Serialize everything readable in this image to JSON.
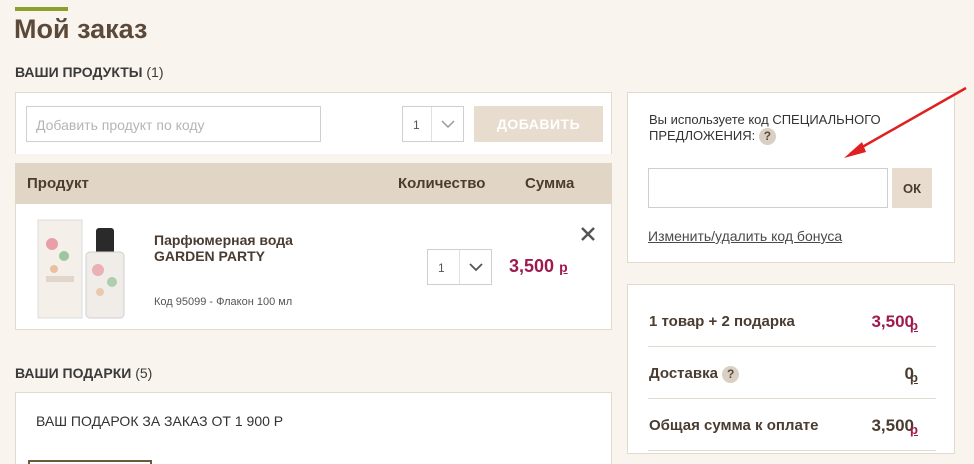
{
  "page": {
    "title": "Мой заказ"
  },
  "products_section": {
    "title": "ВАШИ ПРОДУКТЫ",
    "count": "(1)"
  },
  "add_product": {
    "placeholder": "Добавить продукт по коду",
    "qty": "1",
    "button": "ДОБАВИТЬ"
  },
  "table": {
    "col_product": "Продукт",
    "col_qty": "Количество",
    "col_sum": "Сумма"
  },
  "product": {
    "name_line1": "Парфюмерная вода",
    "name_line2": "GARDEN PARTY",
    "code": "Код 95099 -  Флакон 100 мл",
    "qty": "1",
    "price": "3,500",
    "currency": "р"
  },
  "gifts_section": {
    "title": "ВАШИ ПОДАРКИ",
    "count": "(5)",
    "gift_text": "ВАШ ПОДАРОК ЗА ЗАКАЗ ОТ 1 900 Р"
  },
  "promo": {
    "label_line1": "Вы используете код СПЕЦИАЛЬНОГО",
    "label_line2": "ПРЕДЛОЖЕНИЯ:",
    "help": "?",
    "ok": "ОК",
    "bonus_link": "Изменить/удалить код бонуса"
  },
  "summary": {
    "items_label": "1 товар  + 2 подарка",
    "items_amount": "3,500",
    "delivery_label": "Доставка",
    "delivery_help": "?",
    "delivery_amount": "0",
    "total_label": "Общая сумма к оплате",
    "total_amount": "3,500",
    "currency": "р"
  },
  "colors": {
    "accent": "#9e1b4f",
    "header_bg": "#e1d6c6",
    "page_bg": "#faf4ee",
    "arrow": "#e02020"
  }
}
